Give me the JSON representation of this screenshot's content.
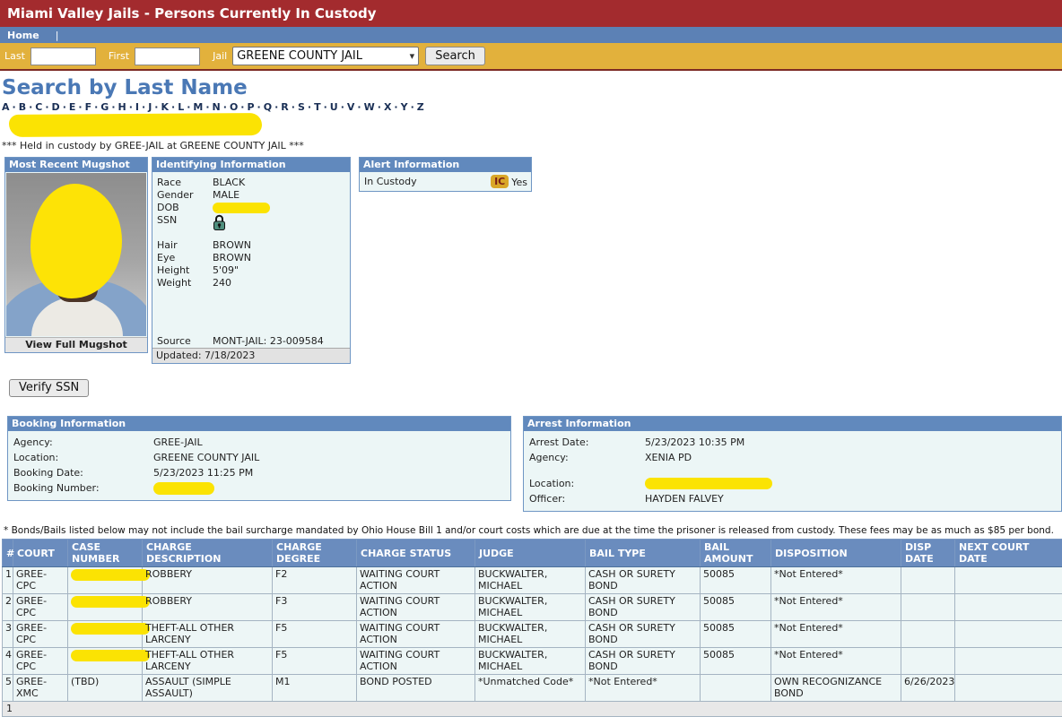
{
  "header": {
    "title": "Miami Valley Jails - Persons Currently In Custody"
  },
  "nav": {
    "home": "Home",
    "separator": "|"
  },
  "search_bar": {
    "last_label": "Last",
    "last_value": "",
    "first_label": "First",
    "first_value": "",
    "jail_label": "Jail",
    "jail_selected": "GREENE COUNTY JAIL",
    "search_button": "Search"
  },
  "page": {
    "heading": "Search by Last Name",
    "alphabet": [
      "A",
      "B",
      "C",
      "D",
      "E",
      "F",
      "G",
      "H",
      "I",
      "J",
      "K",
      "L",
      "M",
      "N",
      "O",
      "P",
      "Q",
      "R",
      "S",
      "T",
      "U",
      "V",
      "W",
      "X",
      "Y",
      "Z"
    ],
    "custody_note": "*** Held in custody by GREE-JAIL at GREENE COUNTY JAIL ***"
  },
  "mugshot": {
    "title": "Most Recent Mugshot",
    "view_full": "View Full Mugshot"
  },
  "identifying": {
    "title": "Identifying Information",
    "race_label": "Race",
    "race": "BLACK",
    "gender_label": "Gender",
    "gender": "MALE",
    "dob_label": "DOB",
    "ssn_label": "SSN",
    "hair_label": "Hair",
    "hair": "BROWN",
    "eye_label": "Eye",
    "eye": "BROWN",
    "height_label": "Height",
    "height": "5'09\"",
    "weight_label": "Weight",
    "weight": "240",
    "source_label": "Source",
    "source": "MONT-JAIL: 23-009584",
    "updated": "Updated: 7/18/2023"
  },
  "alert": {
    "title": "Alert Information",
    "in_custody_label": "In Custody",
    "badge": "IC",
    "value": "Yes"
  },
  "verify_ssn_button": "Verify SSN",
  "booking": {
    "title": "Booking Information",
    "agency_label": "Agency:",
    "agency": "GREE-JAIL",
    "location_label": "Location:",
    "location": "GREENE COUNTY JAIL",
    "date_label": "Booking Date:",
    "date": "5/23/2023 11:25 PM",
    "number_label": "Booking Number:"
  },
  "arrest": {
    "title": "Arrest Information",
    "date_label": "Arrest Date:",
    "date": "5/23/2023 10:35 PM",
    "agency_label": "Agency:",
    "agency": "XENIA PD",
    "location_label": "Location:",
    "officer_label": "Officer:",
    "officer": "HAYDEN FALVEY"
  },
  "bond_note": "* Bonds/Bails listed below may not include the bail surcharge mandated by Ohio House Bill 1 and/or court costs which are due at the time the prisoner is released from custody. These fees may be as much as $85 per bond.",
  "charges_table": {
    "headers": [
      "#",
      "COURT",
      "CASE NUMBER",
      "CHARGE DESCRIPTION",
      "CHARGE DEGREE",
      "CHARGE STATUS",
      "JUDGE",
      "BAIL TYPE",
      "BAIL AMOUNT",
      "DISPOSITION",
      "DISP DATE",
      "NEXT COURT DATE"
    ],
    "rows": [
      {
        "num": "1",
        "court": "GREE-CPC",
        "case_number": "",
        "case_redacted": true,
        "description": "ROBBERY",
        "degree": "F2",
        "status": "WAITING COURT ACTION",
        "judge": "BUCKWALTER, MICHAEL",
        "bail_type": "CASH OR SURETY BOND",
        "bail_amount": "50085",
        "disposition": "*Not Entered*",
        "disp_date": "",
        "next_court_date": ""
      },
      {
        "num": "2",
        "court": "GREE-CPC",
        "case_number": "",
        "case_redacted": true,
        "description": "ROBBERY",
        "degree": "F3",
        "status": "WAITING COURT ACTION",
        "judge": "BUCKWALTER, MICHAEL",
        "bail_type": "CASH OR SURETY BOND",
        "bail_amount": "50085",
        "disposition": "*Not Entered*",
        "disp_date": "",
        "next_court_date": ""
      },
      {
        "num": "3",
        "court": "GREE-CPC",
        "case_number": "",
        "case_redacted": true,
        "description": "THEFT-ALL OTHER LARCENY",
        "degree": "F5",
        "status": "WAITING COURT ACTION",
        "judge": "BUCKWALTER, MICHAEL",
        "bail_type": "CASH OR SURETY BOND",
        "bail_amount": "50085",
        "disposition": "*Not Entered*",
        "disp_date": "",
        "next_court_date": ""
      },
      {
        "num": "4",
        "court": "GREE-CPC",
        "case_number": "",
        "case_redacted": true,
        "description": "THEFT-ALL OTHER LARCENY",
        "degree": "F5",
        "status": "WAITING COURT ACTION",
        "judge": "BUCKWALTER, MICHAEL",
        "bail_type": "CASH OR SURETY BOND",
        "bail_amount": "50085",
        "disposition": "*Not Entered*",
        "disp_date": "",
        "next_court_date": ""
      },
      {
        "num": "5",
        "court": "GREE-XMC",
        "case_number": "(TBD)",
        "case_redacted": false,
        "description": "ASSAULT (SIMPLE ASSAULT)",
        "degree": "M1",
        "status": "BOND POSTED",
        "judge": "*Unmatched Code*",
        "bail_type": "*Not Entered*",
        "bail_amount": "",
        "disposition": "OWN RECOGNIZANCE BOND",
        "disp_date": "6/26/2023",
        "next_court_date": ""
      }
    ],
    "pagination": "1"
  },
  "colors": {
    "title_bar_red": "#a32b2e",
    "nav_blue": "#5c81b5",
    "search_gold": "#e2b13c",
    "panel_header_blue": "#6189bd",
    "table_header_blue": "#6a8cbe",
    "panel_body": "#ecf6f6",
    "heading_blue": "#4a78b5",
    "redaction_yellow": "#fbe303",
    "badge_gold": "#d9a728"
  }
}
